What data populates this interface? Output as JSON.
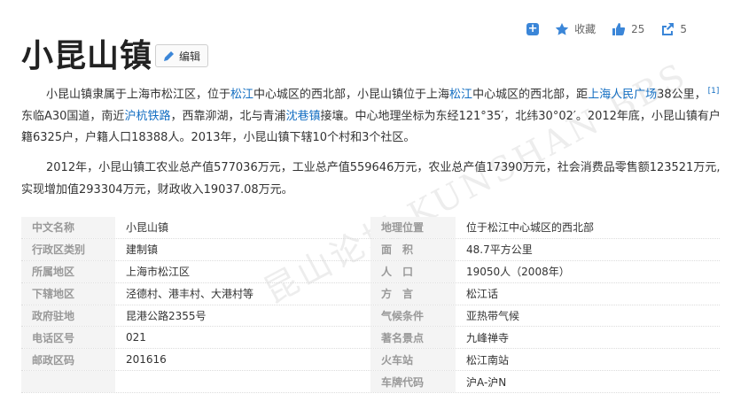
{
  "actions": {
    "add_icon": "plus-icon",
    "favorite_label": "收藏",
    "like_count": "25",
    "share_count": "5"
  },
  "header": {
    "title": "小昆山镇",
    "edit_label": "编辑"
  },
  "paragraph1": {
    "t1": "小昆山镇隶属于上海市松江区，位于",
    "link1": "松江",
    "t2": "中心城区的西北部，小昆山镇位于上海",
    "link2": "松江",
    "t3": "中心城区的西北部，距",
    "link3": "上海人民广场",
    "t4": "38公里，",
    "ref": "[1]",
    "t5": " 东临A30国道，南近",
    "link4": "沪杭铁路",
    "t6": "，西靠泖湖，北与青浦",
    "link5": "沈巷镇",
    "t7": "接壤。中心地理坐标为东经121°35′，北纬30°02′。2012年底，小昆山镇有户籍6325户，户籍人口18388人。2013年，小昆山镇下辖10个村和3个社区。"
  },
  "paragraph2": "2012年，小昆山镇工农业总产值577036万元，工业总产值559646万元，农业总产值17390万元，社会消费品零售额123521万元,实现增加值293304万元，财政收入19037.08万元。",
  "watermark": "昆山论坛 KUNSHAN BBS",
  "info_rows": [
    {
      "l1": "中文名称",
      "v1": "小昆山镇",
      "l2": "地理位置",
      "v2": "位于松江中心城区的西北部"
    },
    {
      "l1": "行政区类别",
      "v1": "建制镇",
      "l2": "面　积",
      "v2": "48.7平方公里"
    },
    {
      "l1": "所属地区",
      "v1": "上海市松江区",
      "l2": "人　口",
      "v2": "19050人（2008年）"
    },
    {
      "l1": "下辖地区",
      "v1": "泾德村、港丰村、大港村等",
      "l2": "方　言",
      "v2": "松江话"
    },
    {
      "l1": "政府驻地",
      "v1": "昆港公路2355号",
      "l2": "气候条件",
      "v2": "亚热带气候"
    },
    {
      "l1": "电话区号",
      "v1": "021",
      "l2": "著名景点",
      "v2": "九峰禅寺"
    },
    {
      "l1": "邮政区码",
      "v1": "201616",
      "l2": "火车站",
      "v2": "松江南站"
    },
    {
      "l1": "",
      "v1": "",
      "l2": "车牌代码",
      "v2": "沪A-沪N"
    }
  ]
}
